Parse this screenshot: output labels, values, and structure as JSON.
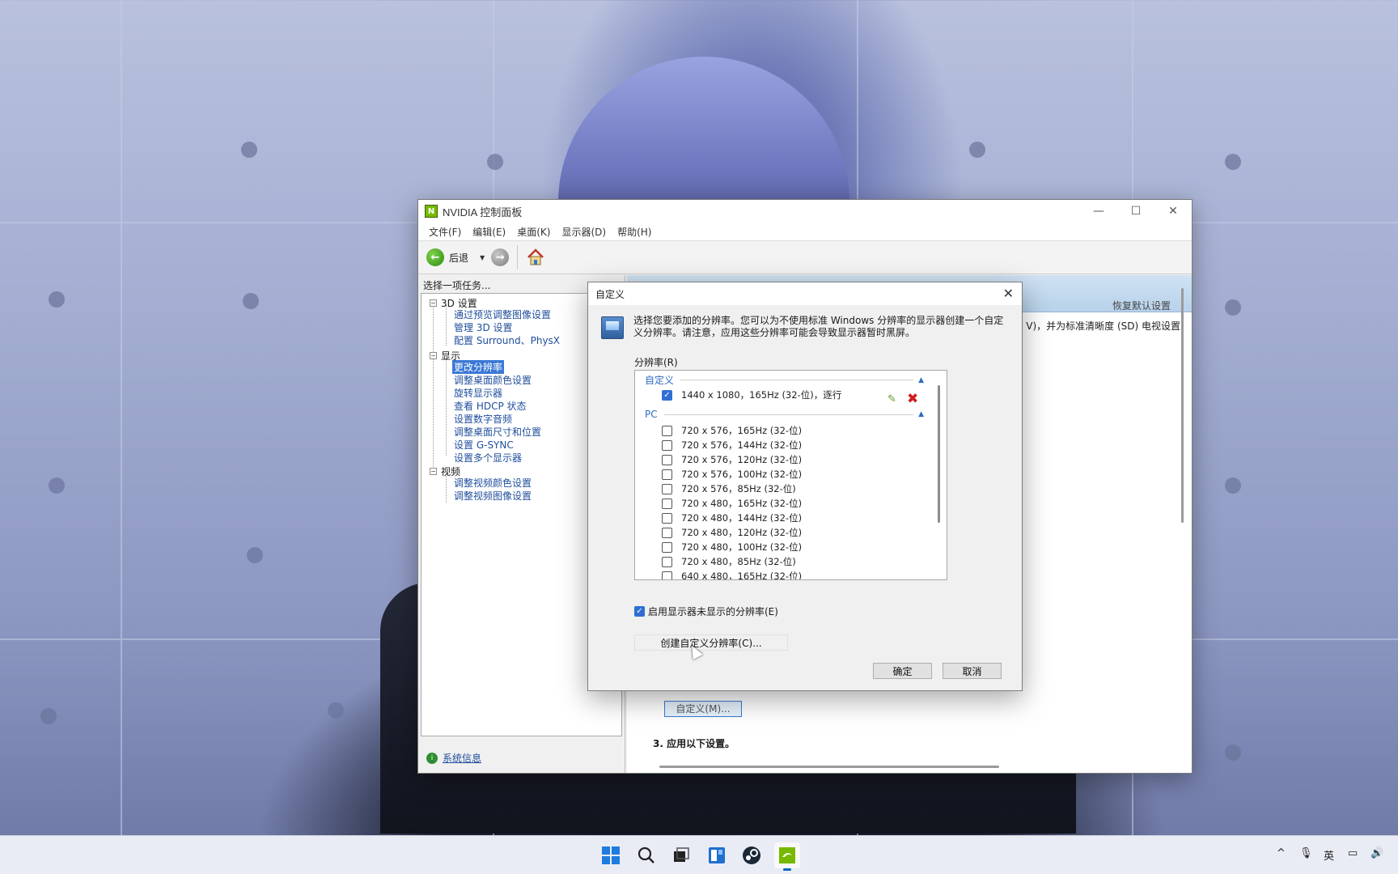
{
  "window": {
    "title": "NVIDIA 控制面板",
    "controls": {
      "minimize": "—",
      "maximize": "☐",
      "close": "✕"
    }
  },
  "menubar": [
    "文件(F)",
    "编辑(E)",
    "桌面(K)",
    "显示器(D)",
    "帮助(H)"
  ],
  "toolbar": {
    "back_label": "后退"
  },
  "left_pane": {
    "heading": "选择一项任务...",
    "categories": [
      {
        "label": "3D 设置",
        "items": [
          "通过预览调整图像设置",
          "管理 3D 设置",
          "配置 Surround、PhysX"
        ]
      },
      {
        "label": "显示",
        "items": [
          "更改分辨率",
          "调整桌面颜色设置",
          "旋转显示器",
          "查看 HDCP 状态",
          "设置数字音频",
          "调整桌面尺寸和位置",
          "设置 G-SYNC",
          "设置多个显示器"
        ]
      },
      {
        "label": "视频",
        "items": [
          "调整视频颜色设置",
          "调整视频图像设置"
        ]
      }
    ],
    "selected_item": "更改分辨率",
    "system_info": "系统信息"
  },
  "right_pane": {
    "restore_default": "恢复默认设置",
    "desc_fragment": "V)，并为标准清晰度 (SD) 电视设置",
    "partial_button": "自定义(M)...",
    "step3": "3.  应用以下设置。"
  },
  "dialog": {
    "title": "自定义",
    "message": "选择您要添加的分辨率。您可以为不使用标准 Windows 分辨率的显示器创建一个自定义分辨率。请注意，应用这些分辨率可能会导致显示器暂时黑屏。",
    "resolution_label": "分辨率(R)",
    "groups": {
      "custom": {
        "label": "自定义",
        "rows": [
          {
            "text": "1440 x 1080，165Hz (32-位)，逐行",
            "checked": true
          }
        ]
      },
      "pc": {
        "label": "PC",
        "rows": [
          {
            "text": "720 x 576，165Hz (32-位)",
            "checked": false
          },
          {
            "text": "720 x 576，144Hz (32-位)",
            "checked": false
          },
          {
            "text": "720 x 576，120Hz (32-位)",
            "checked": false
          },
          {
            "text": "720 x 576，100Hz (32-位)",
            "checked": false
          },
          {
            "text": "720 x 576，85Hz (32-位)",
            "checked": false
          },
          {
            "text": "720 x 480，165Hz (32-位)",
            "checked": false
          },
          {
            "text": "720 x 480，144Hz (32-位)",
            "checked": false
          },
          {
            "text": "720 x 480，120Hz (32-位)",
            "checked": false
          },
          {
            "text": "720 x 480，100Hz (32-位)",
            "checked": false
          },
          {
            "text": "720 x 480，85Hz (32-位)",
            "checked": false
          },
          {
            "text": "640 x 480，165Hz (32-位)",
            "checked": false
          }
        ]
      }
    },
    "show_unsupported": {
      "label": "启用显示器未显示的分辨率(E)",
      "checked": true
    },
    "create_button": "创建自定义分辨率(C)...",
    "ok_button": "确定",
    "cancel_button": "取消"
  },
  "taskbar": {
    "icons": [
      "start-icon",
      "search-icon",
      "task-view-icon",
      "widgets-icon",
      "steam-icon",
      "nvidia-icon"
    ],
    "tray": {
      "chevron": "^",
      "mic": "🎙",
      "ime": "英",
      "network": "▭",
      "volume": "🔊"
    }
  },
  "colors": {
    "accent": "#2f6fd3",
    "nvidia_green": "#76b900",
    "link": "#1f4e9c"
  }
}
